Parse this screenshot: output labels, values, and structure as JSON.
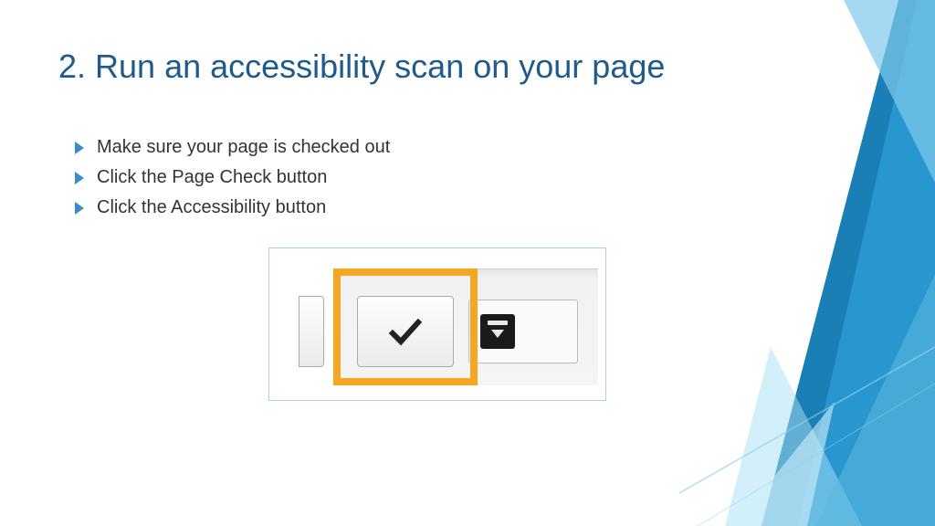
{
  "slide": {
    "title": "2. Run an accessibility scan on your page",
    "bullets": [
      "Make sure your page is checked out",
      "Click the Page Check button",
      "Click the Accessibility button"
    ]
  }
}
